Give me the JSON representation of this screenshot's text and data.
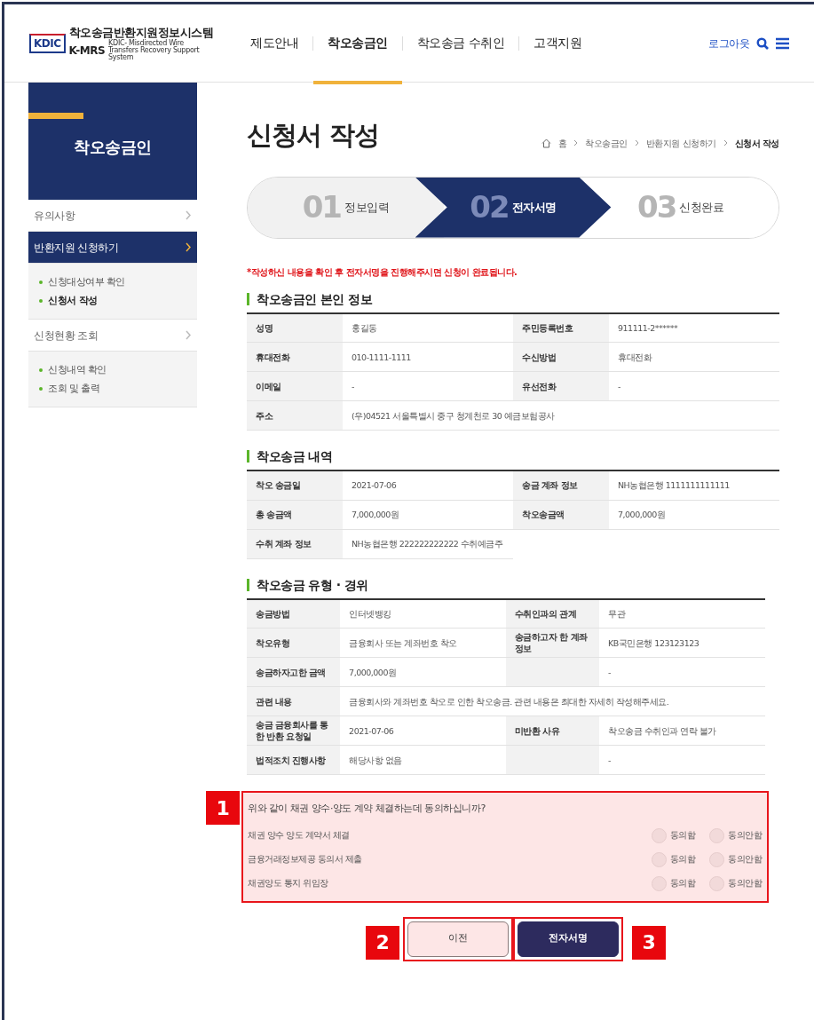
{
  "header": {
    "logo_mark": "KDIC",
    "logo_title": "착오송금반환지원정보시스템",
    "logo_abbr": "K-MRS",
    "logo_subtitle": "KDIC- Misdirected Wire Transfers Recovery Support System",
    "nav": [
      {
        "label": "제도안내",
        "selected": false
      },
      {
        "label": "착오송금인",
        "selected": true
      },
      {
        "label": "착오송금 수취인",
        "selected": false
      },
      {
        "label": "고객지원",
        "selected": false
      }
    ],
    "logout": "로그아웃"
  },
  "sidebar": {
    "title": "착오송금인",
    "items": [
      {
        "label": "유의사항",
        "selected": false
      },
      {
        "label": "반환지원 신청하기",
        "selected": true,
        "children": [
          {
            "label": "신청대상여부 확인",
            "selected": false
          },
          {
            "label": "신청서 작성",
            "selected": true
          }
        ]
      },
      {
        "label": "신청현황 조회",
        "selected": false,
        "children": [
          {
            "label": "신청내역 확인",
            "selected": false
          },
          {
            "label": "조회 및 출력",
            "selected": false
          }
        ]
      }
    ]
  },
  "page_title": "신청서 작성",
  "breadcrumb": [
    "홈",
    "착오송금인",
    "반환지원 신청하기",
    "신청서 작성"
  ],
  "steps": [
    {
      "number": "01",
      "label": "정보입력",
      "done": true,
      "selected": false
    },
    {
      "number": "02",
      "label": "전자서명",
      "done": false,
      "selected": true
    },
    {
      "number": "03",
      "label": "신청완료",
      "done": false,
      "selected": false
    }
  ],
  "notice": "*작성하신 내용을 확인 후 전자서명을 진행해주시면 신청이 완료됩니다.",
  "sections": [
    {
      "title": "착오송금인 본인 정보",
      "rows": [
        {
          "cells": [
            {
              "label": "성명",
              "value": "홍길동"
            },
            {
              "label": "주민등록번호",
              "value": "911111-2******"
            }
          ]
        },
        {
          "cells": [
            {
              "label": "휴대전화",
              "value": "010-1111-1111"
            },
            {
              "label": "수신방법",
              "value": "휴대전화"
            }
          ]
        },
        {
          "cells": [
            {
              "label": "이메일",
              "value": "-"
            },
            {
              "label": "유선전화",
              "value": "-"
            }
          ]
        },
        {
          "cells": [
            {
              "label": "주소",
              "value": "(우)04521 서울특별시 중구 청계천로 30 예금보험공사",
              "wide": true
            }
          ]
        }
      ]
    },
    {
      "title": "착오송금 내역",
      "rows": [
        {
          "cells": [
            {
              "label": "착오 송금일",
              "value": "2021-07-06"
            },
            {
              "label": "송금 계좌 정보",
              "value": "NH농협은행 1111111111111"
            }
          ]
        },
        {
          "cells": [
            {
              "label": "총 송금액",
              "value": "7,000,000원"
            },
            {
              "label": "착오송금액",
              "value": "7,000,000원"
            }
          ]
        },
        {
          "cells": [
            {
              "label": "수취 계좌 정보",
              "value": "NH농협은행 222222222222 수취예금주"
            }
          ]
        }
      ]
    },
    {
      "title": "착오송금 유형 · 경위",
      "rows": [
        {
          "cells": [
            {
              "label": "송금방법",
              "value": "인터넷뱅킹"
            },
            {
              "label": "수취인과의 관계",
              "value": "무관"
            }
          ]
        },
        {
          "cells": [
            {
              "label": "착오유형",
              "value": "금융회사 또는 계좌번호 착오"
            },
            {
              "label": "송금하고자 한 계좌 정보",
              "value": "KB국민은행 123123123"
            }
          ]
        },
        {
          "cells": [
            {
              "label": "송금하자고한 금액",
              "value": "7,000,000원"
            },
            {
              "value": "-"
            }
          ]
        },
        {
          "cells": [
            {
              "label": "관련 내용",
              "value": "금융회사와 계좌번호 착오로 인한 착오송금. 관련 내용은 최대한 자세히 작성해주세요.",
              "wide": true
            }
          ]
        },
        {
          "cells": [
            {
              "label": "송금 금융회사를 통한 반환 요청일",
              "value": "2021-07-06"
            },
            {
              "label": "미반환 사유",
              "value": "착오송금 수취인과 연락 불가"
            }
          ]
        },
        {
          "cells": [
            {
              "label": "법적조치 진행사항",
              "value": "해당사항 없음"
            },
            {
              "value": "-"
            }
          ]
        }
      ]
    }
  ],
  "consent": {
    "annotation": "1",
    "question": "위와 같이 채권 양수·양도 계약 체결하는데 동의하십니까?",
    "items": [
      {
        "label": "채권 양수 양도 계약서 체결",
        "options": [
          {
            "label": "동의함",
            "selected": false
          },
          {
            "label": "동의안함",
            "selected": false
          }
        ]
      },
      {
        "label": "금융거래정보제공 동의서 제출",
        "options": [
          {
            "label": "동의함",
            "selected": false
          },
          {
            "label": "동의안함",
            "selected": false
          }
        ]
      },
      {
        "label": "채권양도 통지 위임장",
        "options": [
          {
            "label": "동의함",
            "selected": false
          },
          {
            "label": "동의안함",
            "selected": false
          }
        ]
      }
    ]
  },
  "buttons": [
    {
      "label": "이전",
      "kind": "secondary",
      "annotation": "2"
    },
    {
      "label": "전자서명",
      "kind": "primary",
      "annotation": "3"
    }
  ]
}
